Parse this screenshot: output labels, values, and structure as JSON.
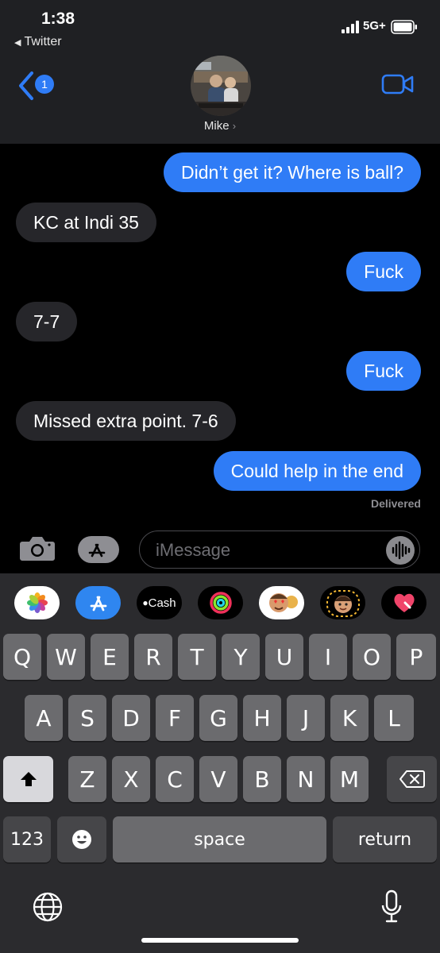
{
  "status_bar": {
    "time": "1:38",
    "back_app": "Twitter",
    "network": "5G+"
  },
  "nav": {
    "back_badge_count": "1",
    "contact_name": "Mike"
  },
  "messages": [
    {
      "direction": "sent",
      "text": "Didn’t get it? Where is ball?"
    },
    {
      "direction": "received",
      "text": "KC at Indi 35"
    },
    {
      "direction": "sent",
      "text": "Fuck"
    },
    {
      "direction": "received",
      "text": "7-7"
    },
    {
      "direction": "sent",
      "text": "Fuck"
    },
    {
      "direction": "received",
      "text": "Missed  extra point. 7-6"
    },
    {
      "direction": "sent",
      "text": "Could help in the end"
    }
  ],
  "delivery_status": "Delivered",
  "composer": {
    "placeholder": "iMessage"
  },
  "app_drawer": {
    "items": [
      "photos-app-icon",
      "app-store-icon",
      "apple-cash-icon",
      "activity-icon",
      "memoji-stickers-icon",
      "memoji-icon",
      "digital-touch-icon"
    ],
    "cash_label": "Cash"
  },
  "keyboard": {
    "row1": [
      "Q",
      "W",
      "E",
      "R",
      "T",
      "Y",
      "U",
      "I",
      "O",
      "P"
    ],
    "row2": [
      "A",
      "S",
      "D",
      "F",
      "G",
      "H",
      "J",
      "K",
      "L"
    ],
    "row3": [
      "Z",
      "X",
      "C",
      "V",
      "B",
      "N",
      "M"
    ],
    "numbers_label": "123",
    "space_label": "space",
    "return_label": "return"
  },
  "colors": {
    "sent_bubble": "#2f7cf6",
    "received_bubble": "#26262a",
    "accent": "#2f7cf6"
  }
}
